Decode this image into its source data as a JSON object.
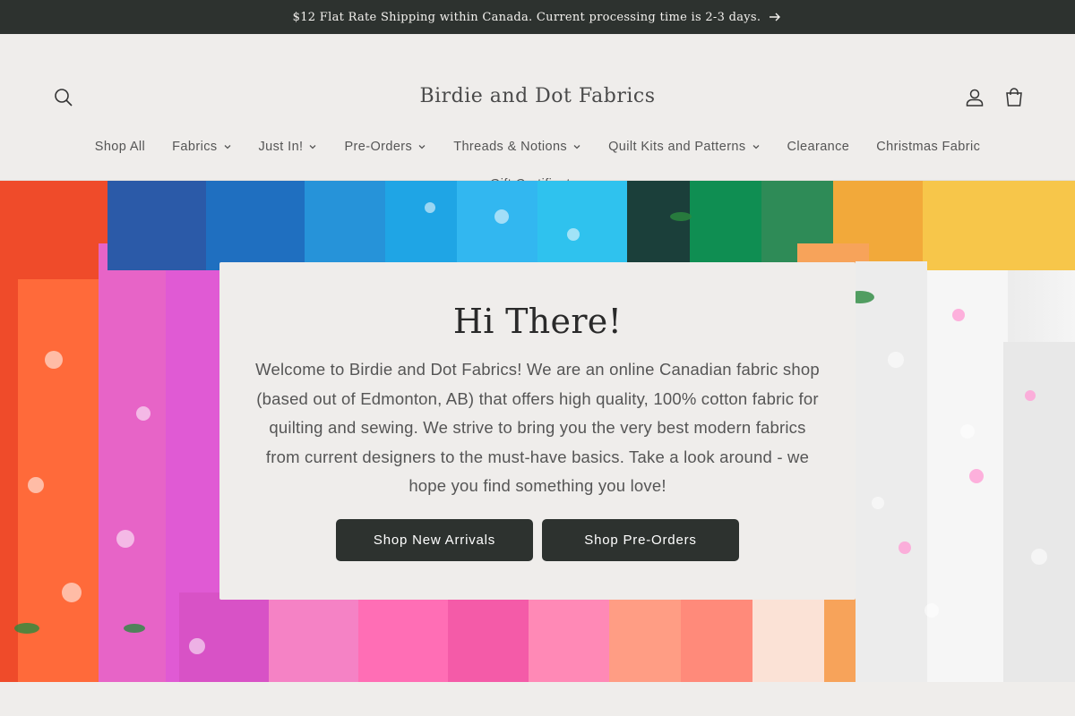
{
  "announcement": {
    "text": "$12 Flat Rate Shipping within Canada. Current processing time is 2-3 days."
  },
  "header": {
    "brand": "Birdie and Dot Fabrics"
  },
  "nav": {
    "row1": [
      {
        "label": "Shop All",
        "dropdown": false
      },
      {
        "label": "Fabrics",
        "dropdown": true
      },
      {
        "label": "Just In!",
        "dropdown": true
      },
      {
        "label": "Pre-Orders",
        "dropdown": true
      },
      {
        "label": "Threads & Notions",
        "dropdown": true
      },
      {
        "label": "Quilt Kits and Patterns",
        "dropdown": true
      },
      {
        "label": "Clearance",
        "dropdown": false
      },
      {
        "label": "Christmas Fabric",
        "dropdown": false
      }
    ],
    "row2": [
      {
        "label": "Gift Certificates",
        "dropdown": false
      }
    ]
  },
  "hero": {
    "heading": "Hi There!",
    "body": "Welcome to Birdie and Dot Fabrics! We are an online Canadian fabric shop (based out of Edmonton, AB) that offers high quality, 100% cotton fabric for quilting and sewing. We strive to bring you the very best modern fabrics from current designers to the must-have basics. Take a look around - we hope you find something you love!",
    "buttons": [
      "Shop New Arrivals",
      "Shop Pre-Orders"
    ]
  },
  "colors": {
    "dark": "#2d322f",
    "background": "#efedeb"
  },
  "icons": [
    "search-icon",
    "account-icon",
    "cart-icon",
    "arrow-right-icon",
    "chevron-down-icon"
  ]
}
